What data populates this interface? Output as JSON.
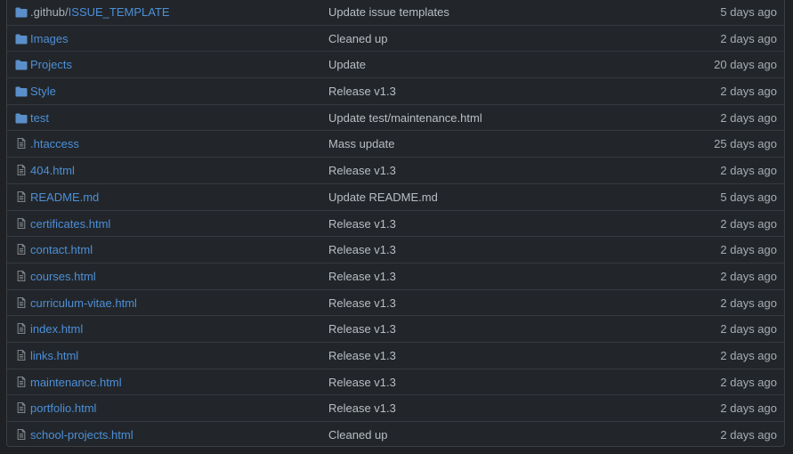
{
  "colors": {
    "background": "#1f2124",
    "link": "#4d8fd8",
    "folder_icon": "#5a8fc9",
    "file_icon": "#8a9096",
    "text": "#b9bec4",
    "border": "#353a40"
  },
  "rows": [
    {
      "type": "folder",
      "icon": "folder-icon",
      "name_prefix": ".github/",
      "name": "ISSUE_TEMPLATE",
      "message": "Update issue templates",
      "age": "5 days ago"
    },
    {
      "type": "folder",
      "icon": "folder-icon",
      "name_prefix": "",
      "name": "Images",
      "message": "Cleaned up",
      "age": "2 days ago"
    },
    {
      "type": "folder",
      "icon": "folder-icon",
      "name_prefix": "",
      "name": "Projects",
      "message": "Update",
      "age": "20 days ago"
    },
    {
      "type": "folder",
      "icon": "folder-icon",
      "name_prefix": "",
      "name": "Style",
      "message": "Release v1.3",
      "age": "2 days ago"
    },
    {
      "type": "folder",
      "icon": "folder-icon",
      "name_prefix": "",
      "name": "test",
      "message": "Update test/maintenance.html",
      "age": "2 days ago"
    },
    {
      "type": "file",
      "icon": "file-icon",
      "name_prefix": "",
      "name": ".htaccess",
      "message": "Mass update",
      "age": "25 days ago"
    },
    {
      "type": "file",
      "icon": "file-icon",
      "name_prefix": "",
      "name": "404.html",
      "message": "Release v1.3",
      "age": "2 days ago"
    },
    {
      "type": "file",
      "icon": "file-icon",
      "name_prefix": "",
      "name": "README.md",
      "message": "Update README.md",
      "age": "5 days ago"
    },
    {
      "type": "file",
      "icon": "file-icon",
      "name_prefix": "",
      "name": "certificates.html",
      "message": "Release v1.3",
      "age": "2 days ago"
    },
    {
      "type": "file",
      "icon": "file-icon",
      "name_prefix": "",
      "name": "contact.html",
      "message": "Release v1.3",
      "age": "2 days ago"
    },
    {
      "type": "file",
      "icon": "file-icon",
      "name_prefix": "",
      "name": "courses.html",
      "message": "Release v1.3",
      "age": "2 days ago"
    },
    {
      "type": "file",
      "icon": "file-icon",
      "name_prefix": "",
      "name": "curriculum-vitae.html",
      "message": "Release v1.3",
      "age": "2 days ago"
    },
    {
      "type": "file",
      "icon": "file-icon",
      "name_prefix": "",
      "name": "index.html",
      "message": "Release v1.3",
      "age": "2 days ago"
    },
    {
      "type": "file",
      "icon": "file-icon",
      "name_prefix": "",
      "name": "links.html",
      "message": "Release v1.3",
      "age": "2 days ago"
    },
    {
      "type": "file",
      "icon": "file-icon",
      "name_prefix": "",
      "name": "maintenance.html",
      "message": "Release v1.3",
      "age": "2 days ago"
    },
    {
      "type": "file",
      "icon": "file-icon",
      "name_prefix": "",
      "name": "portfolio.html",
      "message": "Release v1.3",
      "age": "2 days ago"
    },
    {
      "type": "file",
      "icon": "file-icon",
      "name_prefix": "",
      "name": "school-projects.html",
      "message": "Cleaned up",
      "age": "2 days ago"
    }
  ]
}
